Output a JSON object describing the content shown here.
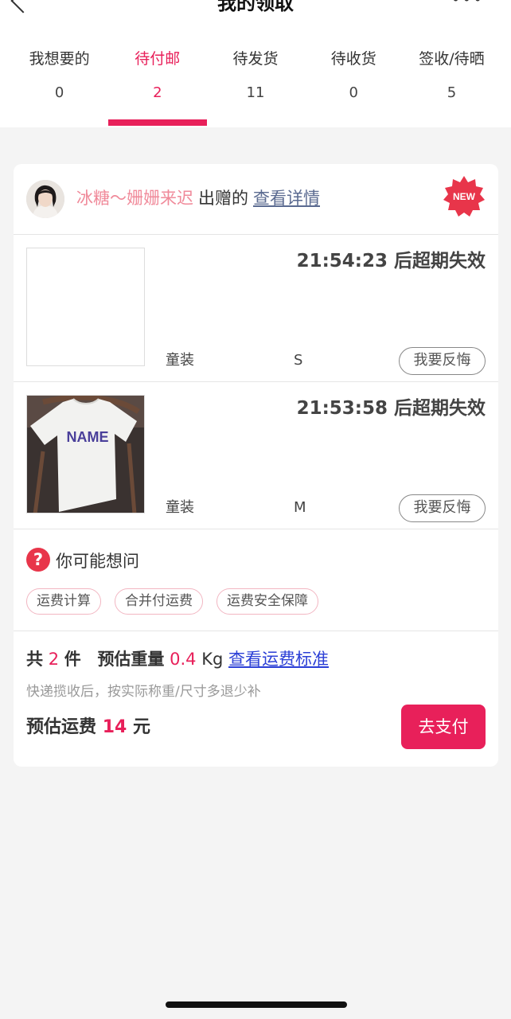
{
  "nav": {
    "title": "我的领取"
  },
  "tabs": [
    {
      "label": "我想要的",
      "count": "0"
    },
    {
      "label": "待付邮",
      "count": "2"
    },
    {
      "label": "待发货",
      "count": "11"
    },
    {
      "label": "待收货",
      "count": "0"
    },
    {
      "label": "签收/待晒",
      "count": "5"
    }
  ],
  "active_tab": "待付邮",
  "giver": {
    "name": "冰糖～姗姗来迟",
    "suffix": "出赠的",
    "detail_link": "查看详情",
    "badge": "NEW"
  },
  "items": [
    {
      "countdown": "21:54:23 后超期失效",
      "category": "童装",
      "size": "S",
      "button": "我要反悔"
    },
    {
      "countdown": "21:53:58 后超期失效",
      "category": "童装",
      "size": "M",
      "button": "我要反悔",
      "image_text": "NAME"
    }
  ],
  "faq": {
    "title": "你可能想问",
    "icon": "question-icon",
    "chips": [
      "运费计算",
      "合并付运费",
      "运费安全保障"
    ]
  },
  "summary": {
    "count_prefix": "共",
    "count": "2",
    "count_suffix": "件",
    "weight_label": "预估重量",
    "weight": "0.4",
    "weight_unit": "Kg",
    "standard_link": "查看运费标准",
    "note": "快递揽收后，按实际称重/尺寸多退少补",
    "fee_label": "预估运费",
    "fee": "14",
    "fee_unit": "元",
    "pay_button": "去支付"
  },
  "colors": {
    "accent": "#e8205a",
    "link_blue": "#2b3fd6",
    "background": "#f4f4f4"
  }
}
